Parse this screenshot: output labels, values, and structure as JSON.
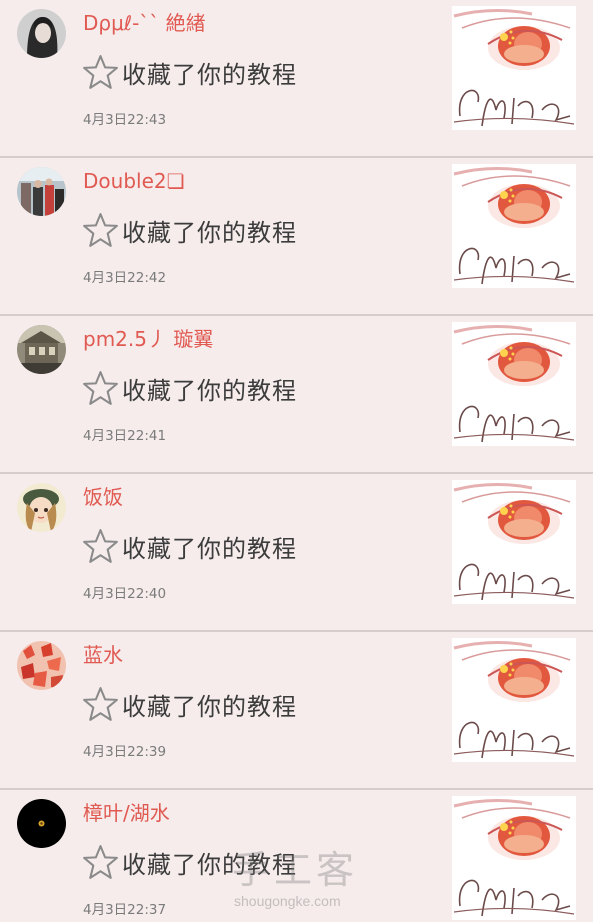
{
  "action_text": "收藏了你的教程",
  "colors": {
    "username": "#e05a52",
    "background": "#f6ecec",
    "divider": "#d6cccc"
  },
  "items": [
    {
      "username": "Dρμℓ-`` 絶緖",
      "time": "4月3日22:43",
      "avatar": "girl-dark-hair",
      "thumbnail": "anime-eye-china"
    },
    {
      "username": "Double2❏",
      "time": "4月3日22:42",
      "avatar": "street-photo",
      "thumbnail": "anime-eye-china"
    },
    {
      "username": "pm2.5丿 璇翼",
      "time": "4月3日22:41",
      "avatar": "building-photo",
      "thumbnail": "anime-eye-china"
    },
    {
      "username": "饭饭",
      "time": "4月3日22:40",
      "avatar": "cartoon-girl-hat",
      "thumbnail": "anime-eye-china"
    },
    {
      "username": "蓝水",
      "time": "4月3日22:39",
      "avatar": "red-maple-leaves",
      "thumbnail": "anime-eye-china"
    },
    {
      "username": "樟叶/湖水",
      "time": "4月3日22:37",
      "avatar": "black-circle-gold-dot",
      "thumbnail": "anime-eye-china"
    }
  ],
  "watermark": {
    "logo_text": "手工客",
    "site": "shougongke.com"
  }
}
